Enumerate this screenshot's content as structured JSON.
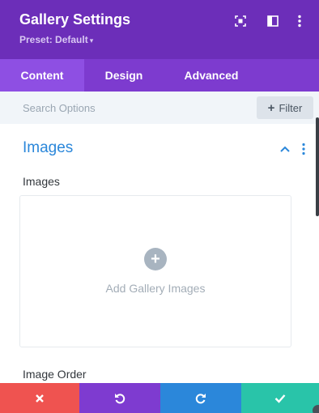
{
  "header": {
    "title": "Gallery Settings",
    "preset": "Preset: Default",
    "icons": [
      "fullscreen-icon",
      "layout-columns-icon",
      "more-vertical-icon"
    ]
  },
  "tabs": [
    {
      "label": "Content",
      "active": true
    },
    {
      "label": "Design",
      "active": false
    },
    {
      "label": "Advanced",
      "active": false
    }
  ],
  "search": {
    "placeholder": "Search Options",
    "filter_label": "Filter"
  },
  "section": {
    "title": "Images",
    "fields": {
      "images_label": "Images",
      "add_images_label": "Add Gallery Images",
      "image_order_label": "Image Order"
    }
  },
  "footer": {
    "buttons": [
      "cancel-icon",
      "undo-icon",
      "redo-icon",
      "save-check-icon"
    ]
  },
  "colors": {
    "header_bg": "#6c2eb9",
    "tabs_bg": "#7d3bcf",
    "active_tab_bg": "#8e4fe3",
    "section_title": "#2b87da",
    "cancel": "#ef5350",
    "undo": "#7e3bd0",
    "redo": "#2b87da",
    "save": "#29c4a9"
  }
}
